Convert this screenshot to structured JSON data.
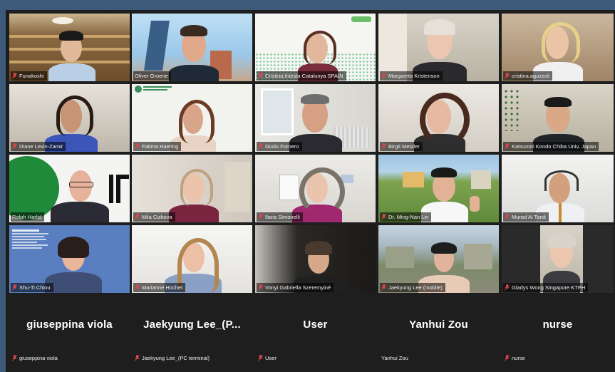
{
  "participants": [
    {
      "name": "Funakoshi",
      "muted": true
    },
    {
      "name": "Oliver Groene",
      "muted": false,
      "active": true
    },
    {
      "name": "Cristina Iniesta Catalunya SPAIN",
      "muted": true
    },
    {
      "name": "Margareta Kristenson",
      "muted": true
    },
    {
      "name": "cristina.aguzzoli",
      "muted": true
    },
    {
      "name": "Diane Levin-Zamir",
      "muted": true
    },
    {
      "name": "Fatima Haering",
      "muted": true
    },
    {
      "name": "Giulio Fornero",
      "muted": true
    },
    {
      "name": "Birgit Metzler",
      "muted": true
    },
    {
      "name": "Katsunori Kondo Chiba Univ, Japan",
      "muted": true
    },
    {
      "name": "Ralph Harlid",
      "muted": true
    },
    {
      "name": "Mila Cizkova",
      "muted": true
    },
    {
      "name": "Ilaria Simonelli",
      "muted": true
    },
    {
      "name": "Dr. Ming-Nan Lin",
      "muted": true
    },
    {
      "name": "Murad Al Tardi",
      "muted": true
    },
    {
      "name": "Shu-Ti Chiou",
      "muted": true
    },
    {
      "name": "Marianne Hochet",
      "muted": true
    },
    {
      "name": "Vonyi Gabriella Szeremyiné",
      "muted": true
    },
    {
      "name": "Jaekyung Lee (mobile)",
      "muted": true
    },
    {
      "name": "Gladys Wong Singapore KTPH",
      "muted": true
    }
  ],
  "audio_only": [
    {
      "display": "giuseppina viola",
      "label": "giuseppina viola",
      "muted": true
    },
    {
      "display": "Jaekyung  Lee_(P...",
      "label": "Jaekyung Lee_(PC terminal)",
      "muted": true
    },
    {
      "display": "User",
      "label": "User",
      "muted": true
    },
    {
      "display": "Yanhui Zou",
      "label": "Yanhui Zou",
      "muted": false
    },
    {
      "display": "nurse",
      "label": "nurse",
      "muted": true
    }
  ],
  "colors": {
    "border": "#3d5a7a",
    "muted_icon": "#e0464b",
    "active_speaker": "#d8c43a"
  }
}
